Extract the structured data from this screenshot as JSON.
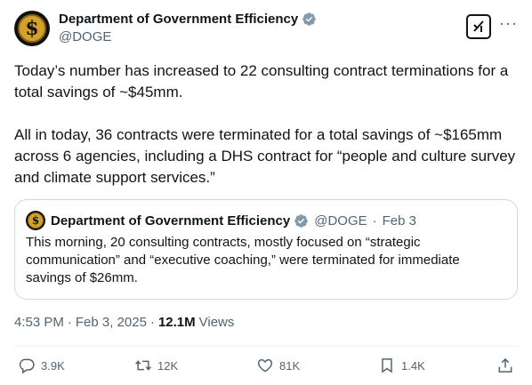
{
  "author": {
    "display_name": "Department of Government Efficiency",
    "handle": "@DOGE"
  },
  "tweet": {
    "paragraphs": [
      "Today’s number has increased to 22 consulting contract terminations for a total savings of ~$45mm.",
      "All in today, 36 contracts were terminated for a total savings of ~$165mm across 6 agencies, including a DHS contract for “people and culture survey and climate support services.”"
    ]
  },
  "quoted": {
    "display_name": "Department of Government Efficiency",
    "handle": "@DOGE",
    "separator": "·",
    "date": "Feb 3",
    "text": "This morning, 20 consulting contracts, mostly focused on “strategic communication” and “executive coaching,” were terminated for immediate savings of $26mm."
  },
  "meta": {
    "time": "4:53 PM",
    "date": "Feb 3, 2025",
    "separator": "·",
    "views_count": "12.1M",
    "views_label": "Views"
  },
  "actions": {
    "replies": "3.9K",
    "reposts": "12K",
    "likes": "81K",
    "bookmarks": "1.4K"
  },
  "icons": {
    "verified_color": "#829aab",
    "avatar_gold": "#d4a22b"
  }
}
